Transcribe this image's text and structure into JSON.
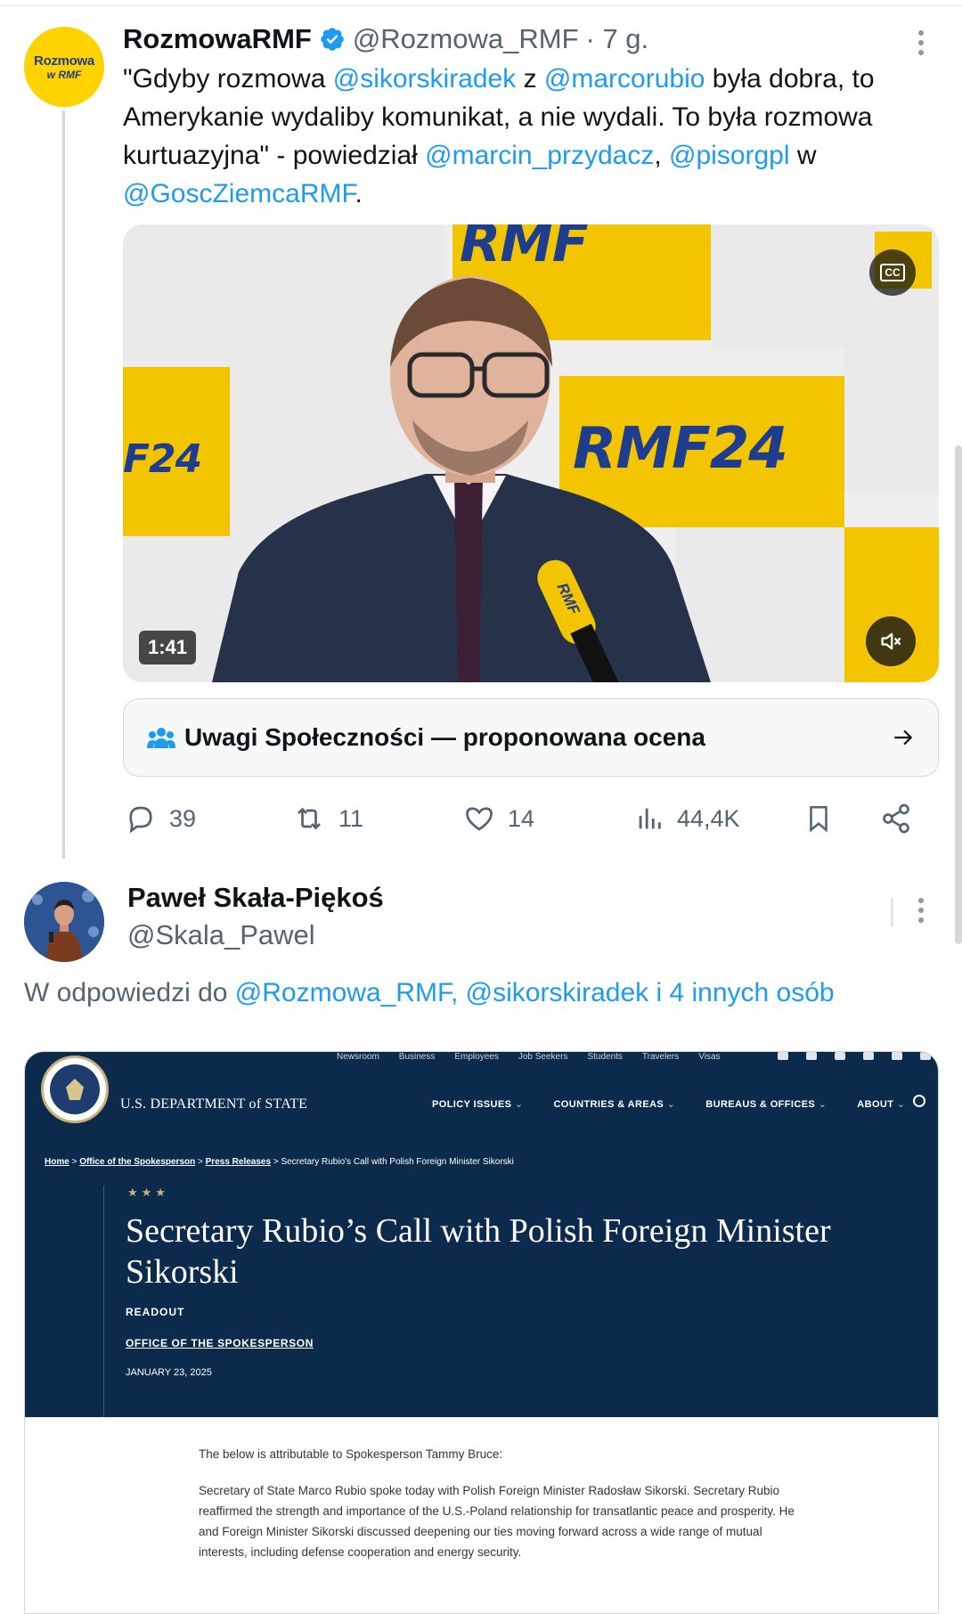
{
  "tweet1": {
    "avatar_line1": "Rozmowa",
    "avatar_line2": "w RMF",
    "name": "RozmowaRMF",
    "handle": "@Rozmowa_RMF",
    "time": "· 7 g.",
    "text": {
      "p1": "\"Gdyby rozmowa ",
      "m1": "@sikorskiradek",
      "p2": " z ",
      "m2": "@marcorubio",
      "p3": " była dobra, to Amerykanie wydaliby komunikat, a nie wydali. To była rozmowa kurtuazyjna\" - powiedział ",
      "m3": "@marcin_przydacz",
      "p4": ", ",
      "m4": "@pisorgpl",
      "p5": " w ",
      "m5": "@GoscZiemcaRMF",
      "p6": "."
    },
    "video": {
      "duration": "1:41",
      "cc_label": "CC",
      "logo_top": "RMF",
      "logo_mid": "RMF24",
      "logo_left": "F24",
      "mic_label": "RMF"
    },
    "community_notes": "Uwagi Społeczności — proponowana ocena",
    "stats": {
      "replies": "39",
      "reposts": "11",
      "likes": "14",
      "views": "44,4K"
    }
  },
  "tweet2": {
    "name": "Paweł Skała-Piękoś",
    "handle": "@Skala_Pawel",
    "reply_prefix": "W odpowiedzi do ",
    "reply_targets": "@Rozmowa_RMF, @sikorskiradek i 4 innych osób"
  },
  "state_dept": {
    "util_links": [
      "Newsroom",
      "Business",
      "Employees",
      "Job Seekers",
      "Students",
      "Travelers",
      "Visas"
    ],
    "org": "U.S. DEPARTMENT of STATE",
    "menu": [
      "POLICY ISSUES",
      "COUNTRIES & AREAS",
      "BUREAUS & OFFICES",
      "ABOUT"
    ],
    "crumbs": [
      "Home",
      "Office of the Spokesperson",
      "Press Releases",
      "Secretary Rubio's Call with Polish Foreign Minister Sikorski"
    ],
    "stars": "★★★",
    "title": "Secretary Rubio’s Call with Polish Foreign Minister Sikorski",
    "readout": "READOUT",
    "office": "OFFICE OF THE SPOKESPERSON",
    "date": "JANUARY 23, 2025",
    "para1": "The below is attributable to Spokesperson Tammy Bruce:",
    "para2": "Secretary of State Marco Rubio spoke today with Polish Foreign Minister Radosław Sikorski.  Secretary Rubio reaffirmed the strength and importance of the U.S.-Poland relationship for transatlantic peace and prosperity.  He and Foreign Minister Sikorski discussed deepening our ties moving forward across a wide range of mutual interests, including defense cooperation and energy security."
  },
  "colors": {
    "link": "#1d9bf0",
    "rmf_yellow": "#f3c400",
    "state_navy": "#0c2a4c"
  }
}
